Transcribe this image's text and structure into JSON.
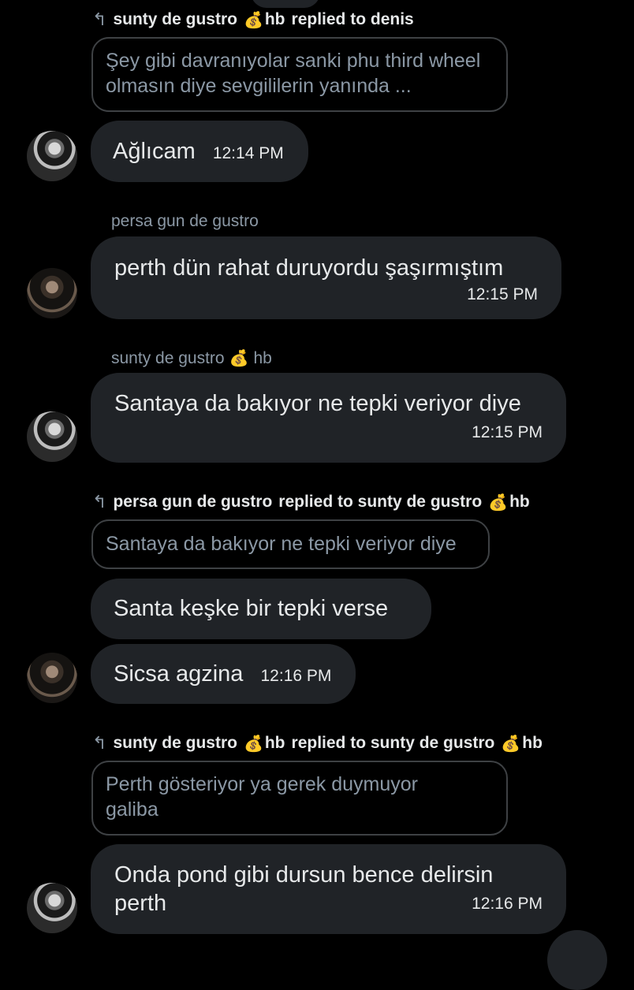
{
  "moneybag": "💰",
  "reply_arrow": "↰",
  "block1": {
    "reply_from": "sunty de gustro",
    "reply_from_suffix": "hb",
    "reply_text": "replied to denis",
    "quote": "Şey gibi davranıyolar sanki phu third wheel olmasın diye sevgililerin yanında ...",
    "message": "Ağlıcam",
    "time": "12:14 PM"
  },
  "block2": {
    "sender": "persa gun de gustro",
    "message": "perth dün rahat duruyordu şaşırmıştım",
    "time": "12:15 PM"
  },
  "block3": {
    "sender": "sunty de gustro",
    "sender_suffix": "hb",
    "message": "Santaya da bakıyor ne tepki veriyor diye",
    "time": "12:15 PM"
  },
  "block4": {
    "reply_from": "persa gun de gustro",
    "reply_text": "replied to sunty de gustro",
    "reply_to_suffix": "hb",
    "quote": "Santaya da bakıyor ne tepki veriyor diye",
    "message1": "Santa keşke bir tepki verse",
    "message2": "Sicsa agzina",
    "time": "12:16 PM"
  },
  "block5": {
    "reply_from": "sunty de gustro",
    "reply_from_suffix": "hb",
    "reply_text": "replied to sunty de gustro",
    "reply_to_suffix": "hb",
    "quote": "Perth gösteriyor ya gerek duymuyor galiba",
    "message": "Onda pond gibi dursun bence delirsin perth",
    "time": "12:16 PM"
  }
}
